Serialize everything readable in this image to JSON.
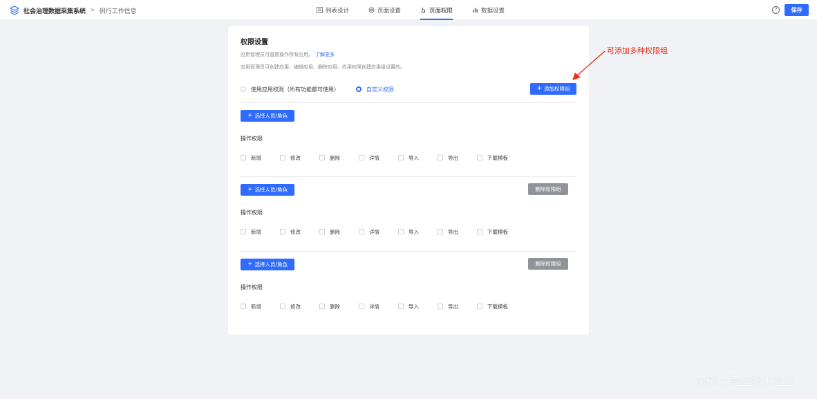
{
  "header": {
    "app_title": "社会治理数据采集系统",
    "breadcrumb_separator": ">",
    "breadcrumb_current": "例行工作信息",
    "tabs": [
      {
        "label": "列表设计",
        "icon": "list-layout-icon",
        "active": false
      },
      {
        "label": "页面设置",
        "icon": "gear-icon",
        "active": false
      },
      {
        "label": "页面权限",
        "icon": "hand-pointer-icon",
        "active": true
      },
      {
        "label": "数据设置",
        "icon": "bar-chart-icon",
        "active": false
      }
    ],
    "help_glyph": "?",
    "save_label": "保存"
  },
  "permission": {
    "title": "权限设置",
    "desc1": "应用管理员可直接操作所有应用。",
    "desc1_link": "了解更多",
    "desc2": "应用管理员可创建应用、编辑应用、删除应用、应用权限创建应用级设置的。",
    "radio_options": [
      {
        "label": "使用应用权限（所有功能都可使用）",
        "checked": false
      },
      {
        "label": "自定义权限",
        "checked": true
      }
    ],
    "add_group_label": "添加权限组",
    "plus_glyph": "+",
    "groups": [
      {
        "select_label": "选择人员/角色",
        "delete_label": "",
        "ops_title": "操作权限",
        "ops": [
          "新增",
          "修改",
          "删除",
          "详情",
          "导入",
          "导出",
          "下载模板"
        ]
      },
      {
        "select_label": "选择人员/角色",
        "delete_label": "删除权限组",
        "ops_title": "操作权限",
        "ops": [
          "新增",
          "修改",
          "删除",
          "详情",
          "导入",
          "导出",
          "下载模板"
        ]
      },
      {
        "select_label": "选择人员/角色",
        "delete_label": "删除权限组",
        "ops_title": "操作权限",
        "ops": [
          "新增",
          "修改",
          "删除",
          "详情",
          "导入",
          "导出",
          "下载模板"
        ]
      }
    ]
  },
  "annotation": {
    "text": "可添加多种权限组",
    "color": "#e8331e"
  },
  "watermark": "@稀土掘金技术社区",
  "colors": {
    "primary": "#2f6bff",
    "gray_button": "#909399",
    "background": "#f0f2f5"
  }
}
